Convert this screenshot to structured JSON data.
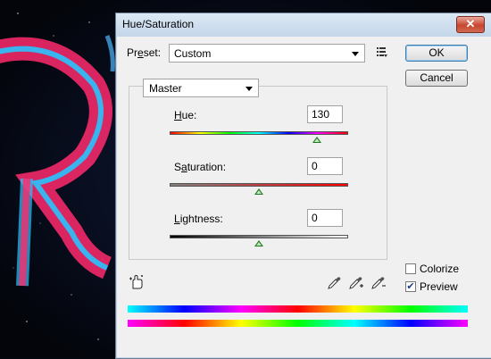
{
  "dialog": {
    "title": "Hue/Saturation",
    "close_label": "✕"
  },
  "preset": {
    "label_pre": "Pr",
    "label_accel": "e",
    "label_post": "set:",
    "value": "Custom"
  },
  "buttons": {
    "ok": "OK",
    "cancel": "Cancel"
  },
  "channel": {
    "value": "Master"
  },
  "hue": {
    "label_accel": "H",
    "label_post": "ue:",
    "value": "130",
    "level": 0.825
  },
  "saturation": {
    "label_pre": "S",
    "label_accel": "a",
    "label_post": "turation:",
    "value": "0",
    "level": 0.5
  },
  "lightness": {
    "label_accel": "L",
    "label_post": "ightness:",
    "value": "0",
    "level": 0.5
  },
  "options": {
    "colorize_label": "Colorize",
    "colorize_checked": false,
    "preview_label": "Preview",
    "preview_checked": true,
    "check_mark": "✔"
  },
  "icons": {
    "preset_menu": "preset-options-icon",
    "targeted_adjust": "targeted-adjustment-hand-icon",
    "eyedropper": "eyedropper-icon",
    "eyedropper_plus": "eyedropper-add-icon",
    "eyedropper_minus": "eyedropper-subtract-icon"
  }
}
